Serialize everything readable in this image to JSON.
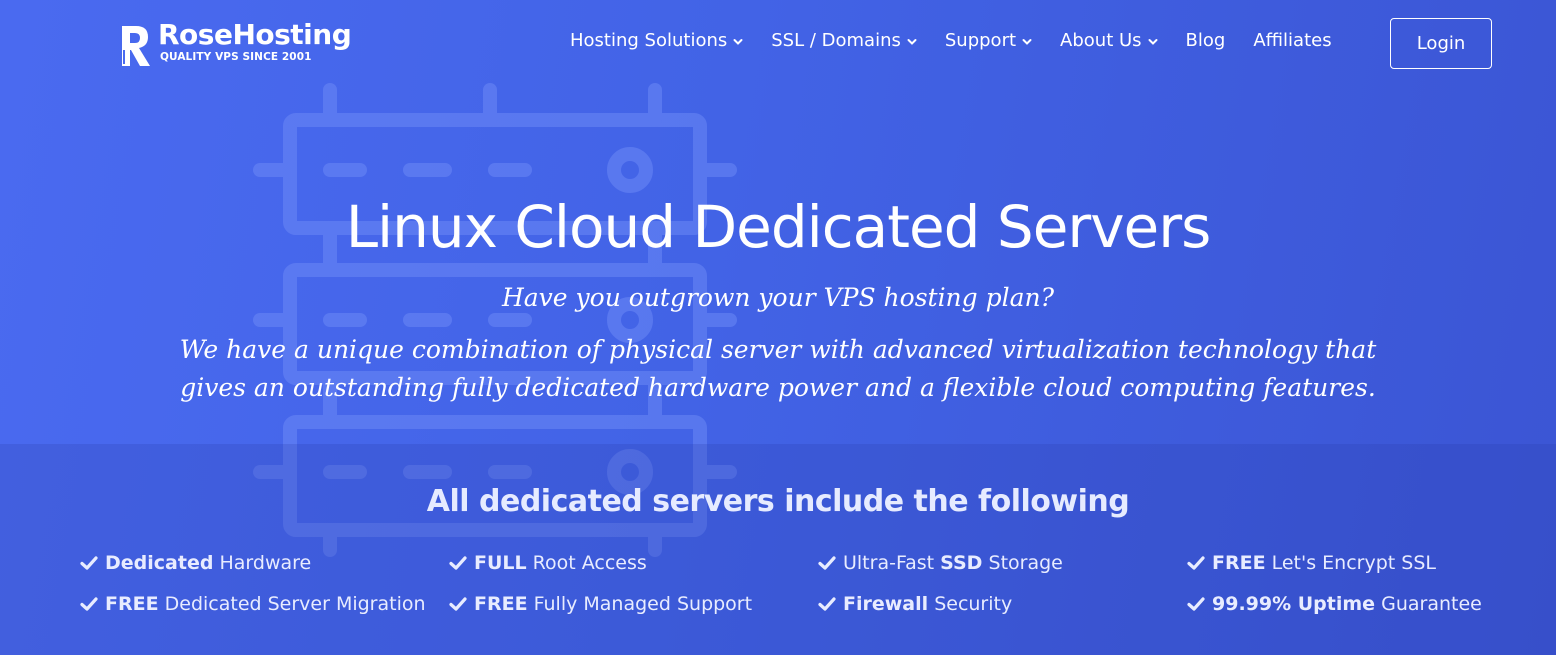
{
  "brand": {
    "name": "RoseHosting",
    "tagline": "QUALITY VPS SINCE 2001",
    "logo_letter": "R"
  },
  "nav": {
    "items": [
      {
        "label": "Hosting Solutions",
        "has_dropdown": true
      },
      {
        "label": "SSL / Domains",
        "has_dropdown": true
      },
      {
        "label": "Support",
        "has_dropdown": true
      },
      {
        "label": "About Us",
        "has_dropdown": true
      },
      {
        "label": "Blog",
        "has_dropdown": false
      },
      {
        "label": "Affiliates",
        "has_dropdown": false
      }
    ],
    "login_label": "Login"
  },
  "hero": {
    "title": "Linux Cloud Dedicated Servers",
    "subtitle": "Have you outgrown your VPS hosting plan?",
    "description": "We have a unique combination of physical server with advanced virtualization technology that gives an outstanding fully dedicated hardware power and a flexible cloud computing features."
  },
  "features": {
    "title": "All dedicated servers include the following",
    "items": [
      {
        "bold": "Dedicated",
        "prefix": "",
        "suffix": " Hardware"
      },
      {
        "bold": "FULL",
        "prefix": "",
        "suffix": " Root Access"
      },
      {
        "bold": "SSD",
        "prefix": "Ultra-Fast ",
        "suffix": " Storage"
      },
      {
        "bold": "FREE",
        "prefix": "",
        "suffix": " Let's Encrypt SSL"
      },
      {
        "bold": "FREE",
        "prefix": "",
        "suffix": " Dedicated Server Migration"
      },
      {
        "bold": "FREE",
        "prefix": "",
        "suffix": " Fully Managed Support"
      },
      {
        "bold": "Firewall",
        "prefix": "",
        "suffix": " Security"
      },
      {
        "bold": "99.99% Uptime",
        "prefix": "",
        "suffix": " Guarantee"
      }
    ]
  },
  "colors": {
    "background_start": "#4a6af0",
    "background_end": "#3b55d4",
    "text": "#ffffff",
    "feature_text": "#e8ecff"
  },
  "icons": {
    "logo": "rosehosting-r-logo",
    "dropdown": "chevron-down-icon",
    "feature": "check-icon",
    "background_art": "server-rack-illustration"
  }
}
